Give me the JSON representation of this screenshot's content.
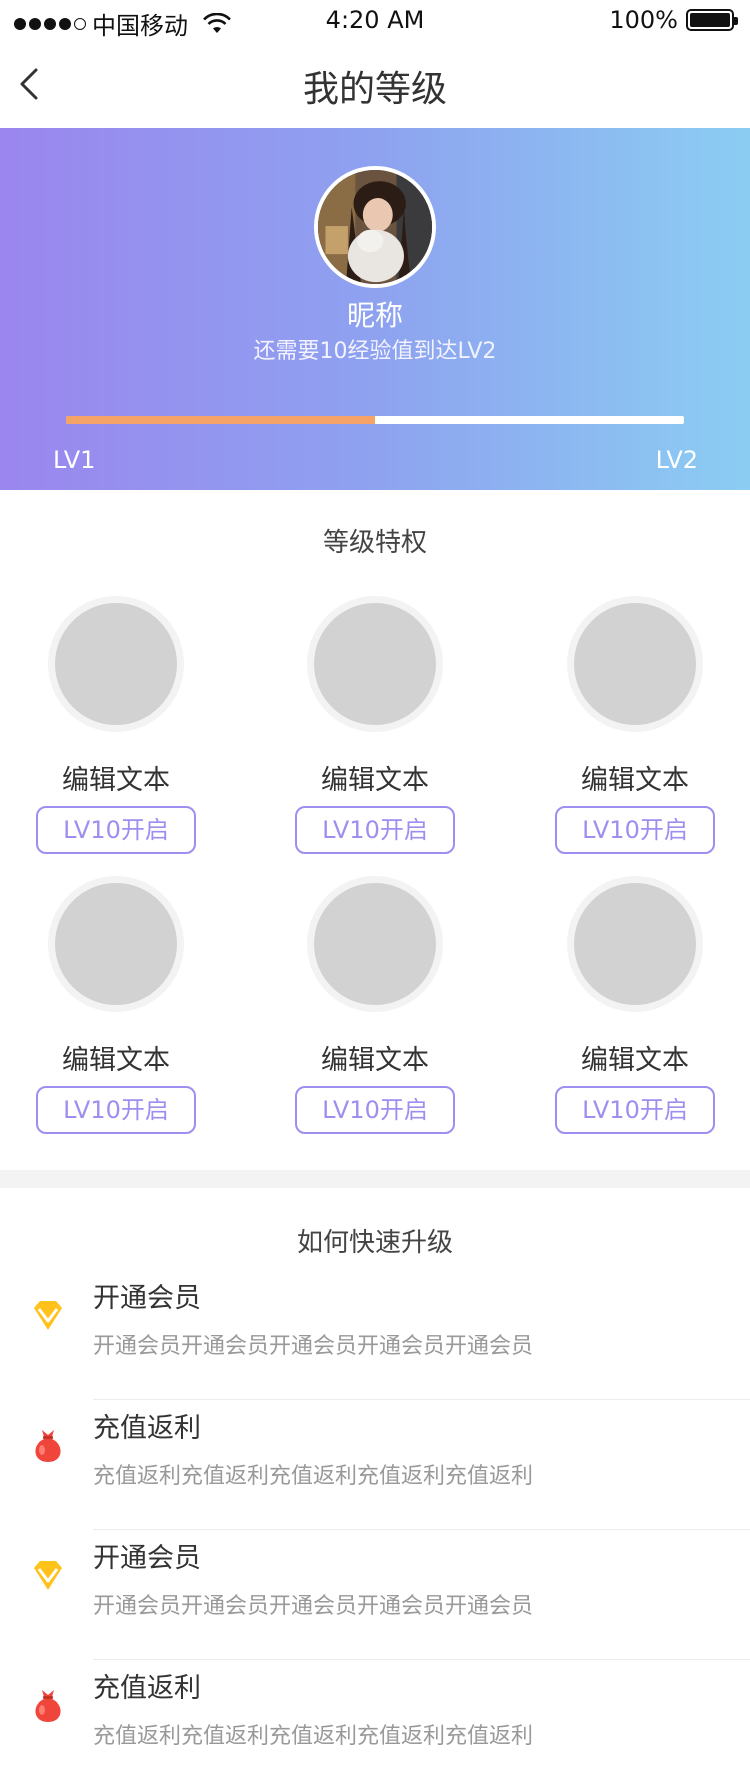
{
  "status_bar": {
    "carrier": "中国移动",
    "time": "4:20 AM",
    "battery": "100%",
    "signal_dots_filled": 4,
    "signal_dots_total": 5
  },
  "nav": {
    "title": "我的等级",
    "back_icon": "chevron-left-icon"
  },
  "profile": {
    "nickname": "昵称",
    "exp_hint": "还需要10经验值到达LV2",
    "level_start": "LV1",
    "level_end": "LV2",
    "progress_fraction": 0.5
  },
  "privileges": {
    "title": "等级特权",
    "items": [
      {
        "name": "编辑文本",
        "badge": "LV10开启"
      },
      {
        "name": "编辑文本",
        "badge": "LV10开启"
      },
      {
        "name": "编辑文本",
        "badge": "LV10开启"
      },
      {
        "name": "编辑文本",
        "badge": "LV10开启"
      },
      {
        "name": "编辑文本",
        "badge": "LV10开启"
      },
      {
        "name": "编辑文本",
        "badge": "LV10开启"
      }
    ]
  },
  "upgrade": {
    "title": "如何快速升级",
    "items": [
      {
        "icon": "diamond-icon",
        "title": "开通会员",
        "desc": "开通会员开通会员开通会员开通会员开通会员"
      },
      {
        "icon": "money-bag-icon",
        "title": "充值返利",
        "desc": "充值返利充值返利充值返利充值返利充值返利"
      },
      {
        "icon": "diamond-icon",
        "title": "开通会员",
        "desc": "开通会员开通会员开通会员开通会员开通会员"
      },
      {
        "icon": "money-bag-icon",
        "title": "充值返利",
        "desc": "充值返利充值返利充值返利充值返利充值返利"
      }
    ]
  },
  "colors": {
    "accent": "#9d8ef0",
    "progress": "#f6a36a",
    "gradient_start": "#9a86ee",
    "gradient_end": "#8bcdf2",
    "diamond": "#ffc21a",
    "bag": "#f0453a"
  }
}
